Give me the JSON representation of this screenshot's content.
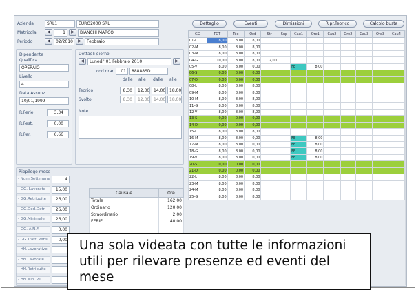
{
  "header": {
    "azienda_label": "Azienda",
    "azienda_code": "SRL1",
    "azienda_name": "EURO2000 SRL",
    "matricola_label": "Matricola",
    "matricola_value": "1",
    "dipendente_name": "BIANCHI MARCO",
    "periodo_label": "Periodo",
    "periodo_value": "02/2010",
    "mese": "Febbraio"
  },
  "dipendente": {
    "dipendente_label": "Dipendente",
    "qualifica_label": "Qualifica",
    "qualifica_value": "OPERAIO",
    "livello_label": "Livello",
    "livello_value": "4",
    "data_assunz_label": "Data Assunz.",
    "data_assunz_value": "10/01/1999",
    "rferie_label": "R.Ferie",
    "rferie_value": "3,34+",
    "rfest_label": "R.Fest.",
    "rfest_value": "0,00+",
    "rper_label": "R.Per.",
    "rper_value": "6,66+"
  },
  "giorno": {
    "title": "Dettagli giorno",
    "day": "Lunedi' 01 Febbraio 2010",
    "cod_orar_label": "cod.orar.",
    "cod_orar_num": "01",
    "cod_orar_code": "88888SD",
    "col_dalle1": "dalle",
    "col_alle1": "alle",
    "col_dalle2": "dalle",
    "col_alle2": "alle",
    "teorico_label": "Teorico",
    "teorico": [
      "8,30",
      "12,30",
      "14,00",
      "18,00"
    ],
    "svolto_label": "Svolto",
    "svolto": [
      "8,30",
      "12,30",
      "14,00",
      "18,00"
    ],
    "note_label": "Note"
  },
  "riepilogo": {
    "title": "Riepilogo mese",
    "rows": [
      {
        "label": "- Num.Settimane",
        "value": "4"
      },
      {
        "label": "- GG. Lavorate",
        "value": "15,00"
      },
      {
        "label": "- GG.Retribuite",
        "value": "26,00"
      },
      {
        "label": "- GG.Ded.Detr.",
        "value": "26,00"
      },
      {
        "label": "- GG.Minimale",
        "value": "26,00"
      },
      {
        "label": "- GG. A.N.F.",
        "value": "0,00"
      },
      {
        "label": "- GG.Tratt. Pens.",
        "value": "0,00"
      },
      {
        "label": "- HH.Lavorative",
        "value": ""
      },
      {
        "label": "- HH.Lavorate",
        "value": ""
      },
      {
        "label": "- HH.Retribuite",
        "value": ""
      },
      {
        "label": "- HH.Min. PT",
        "value": ""
      }
    ]
  },
  "causali": {
    "col_causale": "Causale",
    "col_ore": "Ore",
    "rows": [
      {
        "causale": "Totale",
        "ore": "162,00"
      },
      {
        "causale": "Ordinario",
        "ore": "120,00"
      },
      {
        "causale": "Straordinario",
        "ore": "2,00"
      },
      {
        "causale": "FERIE",
        "ore": "40,00"
      }
    ]
  },
  "tabs": [
    "Dettaglio",
    "Eventi",
    "Dimissioni",
    "Ripr.Teorico",
    "Calcolo busta"
  ],
  "grid": {
    "columns": [
      "GG",
      "TOT",
      "Teo",
      "Ord",
      "Str",
      "Sup",
      "Cau1",
      "Ore1",
      "Cau2",
      "Ore2",
      "Cau3",
      "Ore3",
      "Cau4"
    ],
    "rows": [
      {
        "gg": "01-L",
        "tot": "8,00",
        "teo": "8,00",
        "ord": "8,00",
        "str": "",
        "cau1": "",
        "ore1": "",
        "we": false
      },
      {
        "gg": "02-M",
        "tot": "8,00",
        "teo": "8,00",
        "ord": "8,00",
        "str": "",
        "cau1": "",
        "ore1": "",
        "we": false
      },
      {
        "gg": "03-M",
        "tot": "8,00",
        "teo": "8,00",
        "ord": "8,00",
        "str": "",
        "cau1": "",
        "ore1": "",
        "we": false
      },
      {
        "gg": "04-G",
        "tot": "10,00",
        "teo": "8,00",
        "ord": "8,00",
        "str": "2,00",
        "cau1": "",
        "ore1": "",
        "we": false
      },
      {
        "gg": "05-V",
        "tot": "8,00",
        "teo": "8,00",
        "ord": "0,00",
        "str": "",
        "cau1": "FE",
        "ore1": "8,00",
        "we": false
      },
      {
        "gg": "06-S",
        "tot": "0,00",
        "teo": "0,00",
        "ord": "0,00",
        "str": "",
        "cau1": "",
        "ore1": "",
        "we": true
      },
      {
        "gg": "07-D",
        "tot": "0,00",
        "teo": "0,00",
        "ord": "0,00",
        "str": "",
        "cau1": "",
        "ore1": "",
        "we": true
      },
      {
        "gg": "08-L",
        "tot": "8,00",
        "teo": "8,00",
        "ord": "8,00",
        "str": "",
        "cau1": "",
        "ore1": "",
        "we": false
      },
      {
        "gg": "09-M",
        "tot": "8,00",
        "teo": "8,00",
        "ord": "8,00",
        "str": "",
        "cau1": "",
        "ore1": "",
        "we": false
      },
      {
        "gg": "10-M",
        "tot": "8,00",
        "teo": "8,00",
        "ord": "8,00",
        "str": "",
        "cau1": "",
        "ore1": "",
        "we": false
      },
      {
        "gg": "11-G",
        "tot": "8,00",
        "teo": "8,00",
        "ord": "8,00",
        "str": "",
        "cau1": "",
        "ore1": "",
        "we": false
      },
      {
        "gg": "12-V",
        "tot": "8,00",
        "teo": "8,00",
        "ord": "8,00",
        "str": "",
        "cau1": "",
        "ore1": "",
        "we": false
      },
      {
        "gg": "13-S",
        "tot": "0,00",
        "teo": "0,00",
        "ord": "0,00",
        "str": "",
        "cau1": "",
        "ore1": "",
        "we": true
      },
      {
        "gg": "14-D",
        "tot": "0,00",
        "teo": "0,00",
        "ord": "0,00",
        "str": "",
        "cau1": "",
        "ore1": "",
        "we": true
      },
      {
        "gg": "15-L",
        "tot": "8,00",
        "teo": "8,00",
        "ord": "8,00",
        "str": "",
        "cau1": "",
        "ore1": "",
        "we": false
      },
      {
        "gg": "16-M",
        "tot": "8,00",
        "teo": "8,00",
        "ord": "0,00",
        "str": "",
        "cau1": "FE",
        "ore1": "8,00",
        "we": false
      },
      {
        "gg": "17-M",
        "tot": "8,00",
        "teo": "8,00",
        "ord": "0,00",
        "str": "",
        "cau1": "FE",
        "ore1": "8,00",
        "we": false
      },
      {
        "gg": "18-G",
        "tot": "8,00",
        "teo": "8,00",
        "ord": "0,00",
        "str": "",
        "cau1": "FE",
        "ore1": "8,00",
        "we": false
      },
      {
        "gg": "19-V",
        "tot": "8,00",
        "teo": "8,00",
        "ord": "0,00",
        "str": "",
        "cau1": "FE",
        "ore1": "8,00",
        "we": false
      },
      {
        "gg": "20-S",
        "tot": "0,00",
        "teo": "0,00",
        "ord": "0,00",
        "str": "",
        "cau1": "",
        "ore1": "",
        "we": true
      },
      {
        "gg": "21-D",
        "tot": "0,00",
        "teo": "0,00",
        "ord": "0,00",
        "str": "",
        "cau1": "",
        "ore1": "",
        "we": true
      },
      {
        "gg": "22-L",
        "tot": "8,00",
        "teo": "8,00",
        "ord": "8,00",
        "str": "",
        "cau1": "",
        "ore1": "",
        "we": false
      },
      {
        "gg": "23-M",
        "tot": "8,00",
        "teo": "8,00",
        "ord": "8,00",
        "str": "",
        "cau1": "",
        "ore1": "",
        "we": false
      },
      {
        "gg": "24-M",
        "tot": "8,00",
        "teo": "8,00",
        "ord": "8,00",
        "str": "",
        "cau1": "",
        "ore1": "",
        "we": false
      },
      {
        "gg": "25-G",
        "tot": "8,00",
        "teo": "8,00",
        "ord": "8,00",
        "str": "",
        "cau1": "",
        "ore1": "",
        "we": false
      }
    ]
  },
  "caption": "Una sola videata con tutte le informazioni utili per rilevare presenze ed eventi del mese",
  "colors": {
    "weekend": "#9ccf3c",
    "ferie": "#3ec8c0",
    "selected": "#4a7fd0"
  }
}
